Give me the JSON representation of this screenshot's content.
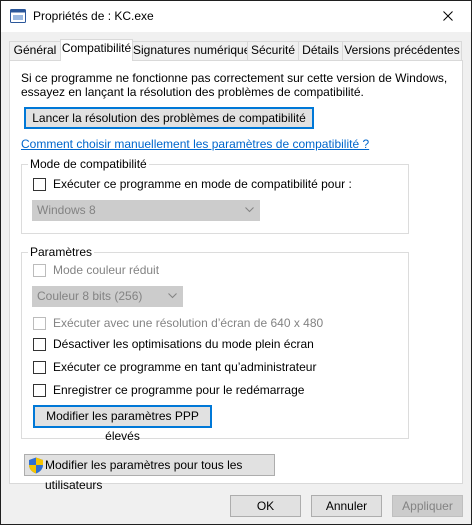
{
  "window": {
    "title": "Propriétés de : KC.exe",
    "close_glyph": "✕"
  },
  "tabs": [
    {
      "label": "Général",
      "active": false
    },
    {
      "label": "Compatibilité",
      "active": true
    },
    {
      "label": "Signatures numériques",
      "active": false
    },
    {
      "label": "Sécurité",
      "active": false
    },
    {
      "label": "Détails",
      "active": false
    },
    {
      "label": "Versions précédentes",
      "active": false
    }
  ],
  "intro": {
    "line1": "Si ce programme ne fonctionne pas correctement sur cette version de Windows,",
    "line2": "essayez en lançant la résolution des problèmes de compatibilité."
  },
  "troubleshoot_button": "Lancer la résolution des problèmes de compatibilité",
  "manual_link": "Comment choisir manuellement les paramètres de compatibilité ?",
  "compat_mode": {
    "group_label": "Mode de compatibilité",
    "checkbox_label": "Exécuter ce programme en mode de compatibilité pour :",
    "checked": false,
    "select_value": "Windows 8"
  },
  "settings": {
    "group_label": "Paramètres",
    "reduced_color_label": "Mode couleur réduit",
    "color_select_value": "Couleur 8 bits (256)",
    "resolution_label": "Exécuter avec une résolution d’écran de 640 x 480",
    "fullscreen_label": "Désactiver les optimisations du mode plein écran",
    "admin_label": "Exécuter ce programme en tant qu’administrateur",
    "restart_label": "Enregistrer ce programme pour le redémarrage",
    "dpi_button": "Modifier les paramètres PPP élevés"
  },
  "all_users_button": "Modifier les paramètres pour tous les utilisateurs",
  "footer": {
    "ok": "OK",
    "cancel": "Annuler",
    "apply": "Appliquer"
  }
}
